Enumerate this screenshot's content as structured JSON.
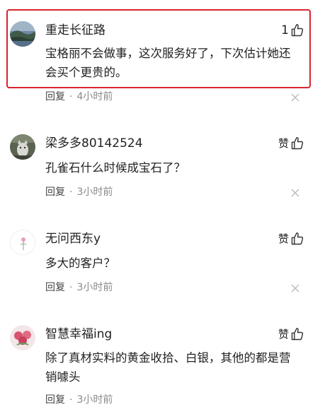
{
  "comments": [
    {
      "username": "重走长征路",
      "like_count": "1",
      "text": "宝格丽不会做事，这次服务好了，下次估计她还会买个更贵的。",
      "reply_label": "回复",
      "separator": "·",
      "time": "4小时前",
      "avatar": "landscape-avatar"
    },
    {
      "username": "梁多多80142524",
      "like_label": "赞",
      "text": "孔雀石什么时候成宝石了？",
      "reply_label": "回复",
      "separator": "·",
      "time": "3小时前",
      "avatar": "cat-avatar"
    },
    {
      "username": "无问西东y",
      "like_label": "赞",
      "text": "多大的客户？",
      "reply_label": "回复",
      "separator": "·",
      "time": "3小时前",
      "avatar": "flower-sketch-avatar"
    },
    {
      "username": "智慧幸福ing",
      "like_label": "赞",
      "text": "除了真材实料的黄金收拾、白银，其他的都是营销噱头",
      "reply_label": "回复",
      "separator": "·",
      "time": "3小时前",
      "avatar": "roses-avatar"
    }
  ],
  "icons": {
    "like": "thumbs-up-icon",
    "close": "close-icon"
  },
  "colors": {
    "highlight_border": "#d9242c",
    "text": "#222222",
    "meta": "#8a8a8a"
  }
}
